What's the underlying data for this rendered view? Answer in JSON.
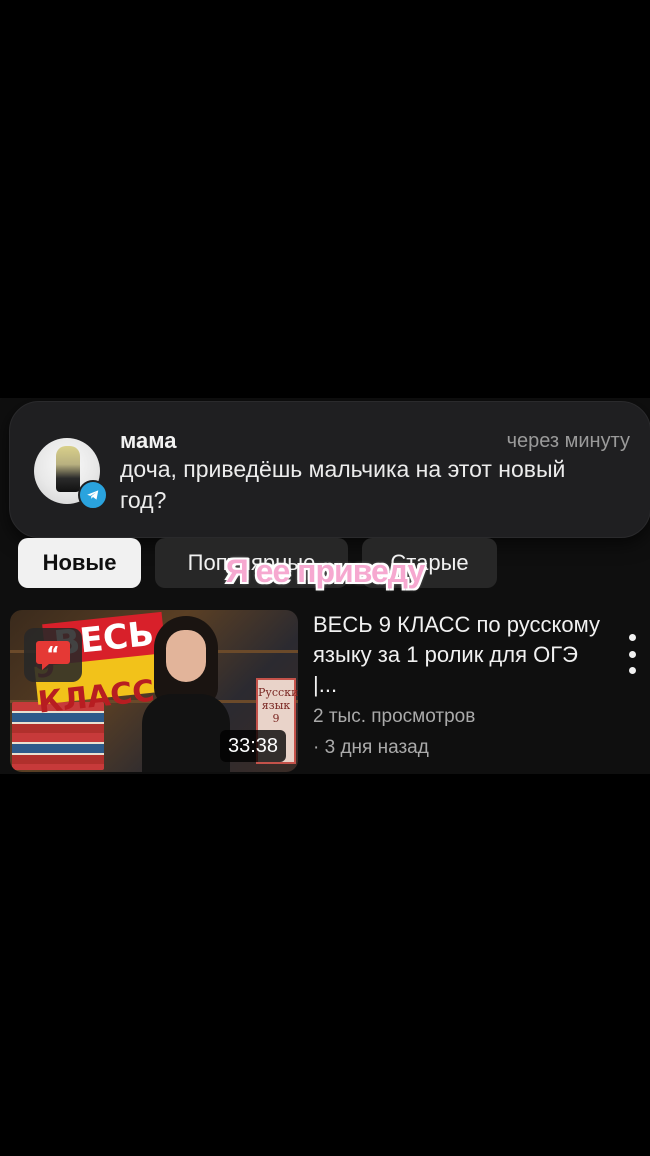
{
  "notification": {
    "sender": "мама",
    "time": "через минуту",
    "message": "доча, приведёшь мальчика на этот новый год?",
    "app_icon": "telegram-icon"
  },
  "filters": {
    "items": [
      {
        "label": "Новые",
        "active": true
      },
      {
        "label": "Популярные",
        "active": false
      },
      {
        "label": "Старые",
        "active": false
      }
    ]
  },
  "overlay_caption": "Я ее приведу",
  "video": {
    "title": "ВЕСЬ 9 КЛАСС по русскому языку за 1 ролик для ОГЭ |...",
    "views": "2 тыс. просмотров",
    "date": "· 3 дня назад",
    "duration": "33:38",
    "thumbnail_text_1": "ВЕСЬ",
    "thumbnail_text_2": "9 КЛАСС",
    "thumbnail_book": "Русский язык 9",
    "menu_icon": "kebab-menu-icon",
    "quote_icon": "quote-bubble-icon"
  },
  "colors": {
    "background": "#000000",
    "accent_red": "#e53935",
    "telegram_blue": "#2aa3de",
    "overlay_pink": "#f6a8d0"
  }
}
